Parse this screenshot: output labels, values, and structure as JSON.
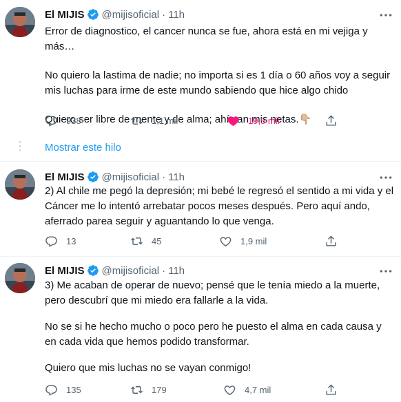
{
  "tweets": [
    {
      "name": "El MIJIS",
      "handle": "@mijisoficial",
      "dot": "·",
      "time": "11h",
      "paragraphs": [
        "Error de diagnostico, el cancer nunca se fue, ahora está en mi vejiga y más…",
        "No quiero la lastima de nadie; no importa si es 1 día o 60 años voy a seguir mis luchas para irme de este mundo sabiendo que hice algo chido",
        "Quiero ser libre de mente y de alma; ahí van mis netas."
      ],
      "emoji": "👇🏼",
      "replies": "938",
      "retweets": "1,1 mil",
      "likes": "19,5 mil",
      "liked": true
    },
    {
      "name": "El MIJIS",
      "handle": "@mijisoficial",
      "dot": "·",
      "time": "11h",
      "paragraphs": [
        "2) Al chile me pegó la depresión; mi bebé le regresó el sentido a mi vida y el Cáncer me lo intentó arrebatar pocos meses después. Pero aquí ando, aferrado parea seguir y aguantando lo que venga."
      ],
      "replies": "13",
      "retweets": "45",
      "likes": "1,9 mil",
      "liked": false
    },
    {
      "name": "El MIJIS",
      "handle": "@mijisoficial",
      "dot": "·",
      "time": "11h",
      "paragraphs": [
        "3) Me acaban de operar de nuevo; pensé que le tenía miedo a la muerte, pero descubrí que mi miedo era fallarle a la vida.",
        "No se si he hecho mucho o poco pero he puesto el alma en cada causa y en cada vida que hemos podido transformar.",
        "Quiero que mis luchas no se vayan conmigo!"
      ],
      "replies": "135",
      "retweets": "179",
      "likes": "4,7 mil",
      "liked": false
    }
  ],
  "show_thread": "Mostrar este hilo",
  "colors": {
    "accent": "#1d9bf0",
    "like_active": "#f91880",
    "muted": "#536471",
    "text": "#0f1419"
  },
  "icons": [
    "avatar",
    "verified-badge-icon",
    "more-options-icon",
    "reply-icon",
    "retweet-icon",
    "like-icon",
    "share-icon"
  ]
}
